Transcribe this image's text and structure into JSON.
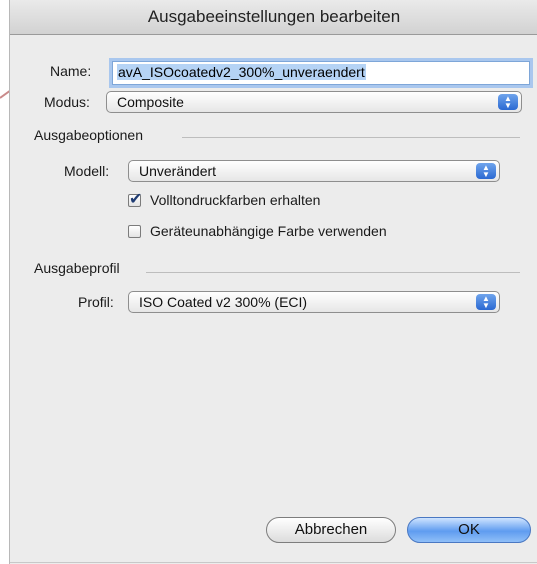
{
  "dialog": {
    "title": "Ausgabeeinstellungen bearbeiten"
  },
  "name": {
    "label": "Name:",
    "value": "avA_ISOcoatedv2_300%_unveraendert"
  },
  "modus": {
    "label": "Modus:",
    "value": "Composite"
  },
  "ausgabeoptionen": {
    "heading": "Ausgabeoptionen",
    "modell_label": "Modell:",
    "modell_value": "Unverändert",
    "checkbox_volltondruck": {
      "label": "Volltondruckfarben erhalten",
      "checked": true
    },
    "checkbox_geraeteunabhaengig": {
      "label": "Geräteunabhängige Farbe verwenden",
      "checked": false
    }
  },
  "ausgabeprofil": {
    "heading": "Ausgabeprofil",
    "profil_label": "Profil:",
    "profil_value": "ISO Coated v2 300% (ECI)"
  },
  "buttons": {
    "cancel": "Abbrechen",
    "ok": "OK"
  },
  "colors": {
    "accent": "#5f9cf0",
    "arrow_annotation": "#c98a8a"
  }
}
